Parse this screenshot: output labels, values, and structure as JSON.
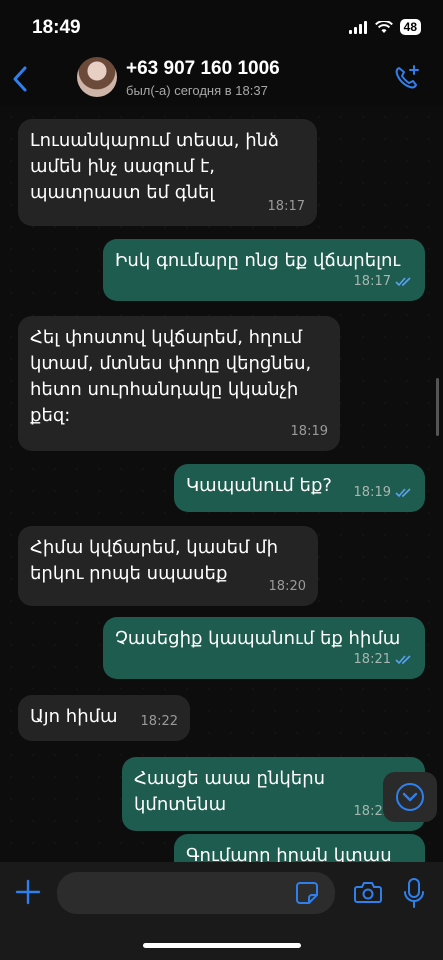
{
  "status_bar": {
    "time": "18:49",
    "battery": "48"
  },
  "header": {
    "contact_name": "+63 907 160 1006",
    "last_seen": "был(-а) сегодня в 18:37"
  },
  "messages": [
    {
      "direction": "in",
      "text": "Լուսանկարում տեսա, ինձ ամեն ինչ սազում է, պատրաստ եմ գնել",
      "time": "18:17"
    },
    {
      "direction": "out",
      "text": "Իսկ գումարը ոնց եք վճարելու",
      "time": "18:17",
      "read": true
    },
    {
      "direction": "in",
      "text": "Հել փոստով կվճարեմ, հղում կտամ, մտնես փողը վերցնես, հետո սուրհանդակը կկանչի քեզ:",
      "time": "18:19"
    },
    {
      "direction": "out",
      "text": "Կապանում եք?",
      "time": "18:19",
      "read": true
    },
    {
      "direction": "in",
      "text": "Հիմա կվճարեմ, կասեմ մի երկու րոպե սպասեք",
      "time": "18:20"
    },
    {
      "direction": "out",
      "text": "Չասեցիք կապանում եք հիմա",
      "time": "18:21",
      "read": true
    },
    {
      "direction": "in",
      "text": "Այո հիմա",
      "time": "18:22"
    },
    {
      "direction": "out",
      "text": "Հասցե ասա ընկերս կմոտենա",
      "time": "18:22",
      "read": true
    },
    {
      "direction": "out",
      "text": "Գումարը իրան կտաս",
      "time": "",
      "read": false
    }
  ],
  "colors": {
    "accent": "#2f80ed",
    "outgoing_bubble": "#1d5c4e",
    "incoming_bubble": "#242424"
  },
  "icons": {
    "back": "chevron-left-icon",
    "call_add": "phone-plus-icon",
    "plus": "plus-icon",
    "sticker": "sticker-icon",
    "camera": "camera-icon",
    "mic": "microphone-icon",
    "scroll_down": "chevron-down-icon"
  }
}
